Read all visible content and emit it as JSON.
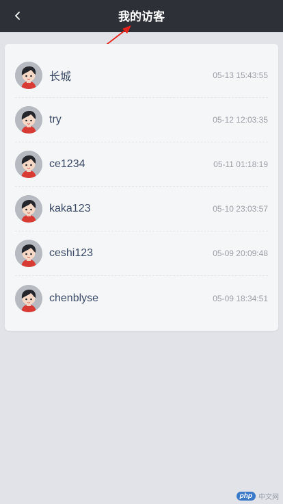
{
  "header": {
    "title": "我的访客",
    "back_icon": "chevron-left-icon",
    "background": "#2d3037"
  },
  "annotation": {
    "color": "#e8221b",
    "icon": "red-arrow"
  },
  "visitors": [
    {
      "name": "长城",
      "time": "05-13 15:43:55",
      "avatar": "avatar-boy-icon"
    },
    {
      "name": "try",
      "time": "05-12 12:03:35",
      "avatar": "avatar-boy-icon"
    },
    {
      "name": "ce1234",
      "time": "05-11 01:18:19",
      "avatar": "avatar-boy-icon"
    },
    {
      "name": "kaka123",
      "time": "05-10 23:03:57",
      "avatar": "avatar-boy-icon"
    },
    {
      "name": "ceshi123",
      "time": "05-09 20:09:48",
      "avatar": "avatar-boy-icon"
    },
    {
      "name": "chenblyse",
      "time": "05-09 18:34:51",
      "avatar": "avatar-boy-icon"
    }
  ],
  "watermark": {
    "logo": "php",
    "text": "中文网"
  }
}
